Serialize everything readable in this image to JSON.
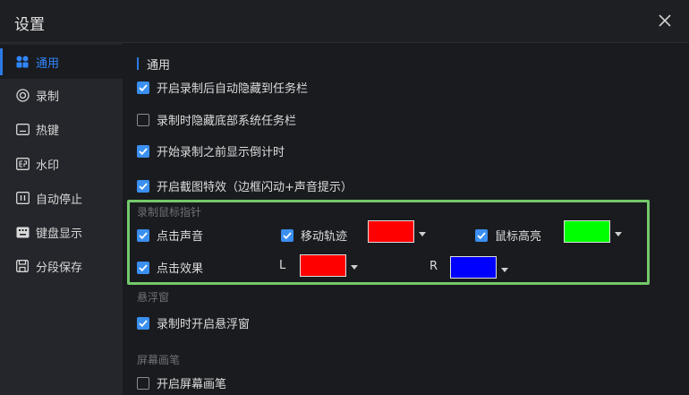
{
  "window": {
    "title": "设置"
  },
  "sidebar": {
    "items": [
      {
        "label": "通用",
        "icon": "grid-icon",
        "active": true
      },
      {
        "label": "录制",
        "icon": "record-icon"
      },
      {
        "label": "热键",
        "icon": "keyboard-icon"
      },
      {
        "label": "水印",
        "icon": "watermark-icon"
      },
      {
        "label": "自动停止",
        "icon": "stop-timer-icon"
      },
      {
        "label": "键盘显示",
        "icon": "keyboard-display-icon"
      },
      {
        "label": "分段保存",
        "icon": "save-icon"
      }
    ]
  },
  "general": {
    "title": "通用",
    "options": [
      {
        "label": "开启录制后自动隐藏到任务栏",
        "checked": true
      },
      {
        "label": "录制时隐藏底部系统任务栏",
        "checked": false
      },
      {
        "label": "开始录制之前显示倒计时",
        "checked": true
      },
      {
        "label": "开启截图特效（边框闪动+声音提示）",
        "checked": true
      }
    ]
  },
  "mouse": {
    "title": "录制鼠标指针",
    "click_sound": {
      "label": "点击声音",
      "checked": true
    },
    "move_track": {
      "label": "移动轨迹",
      "checked": true,
      "color": "#ff0000"
    },
    "highlight": {
      "label": "鼠标高亮",
      "checked": true,
      "color": "#00ff00"
    },
    "click_effect": {
      "label": "点击效果",
      "checked": true
    },
    "left": {
      "label": "L",
      "color": "#ff0000"
    },
    "right": {
      "label": "R",
      "color": "#0000ff"
    }
  },
  "floating": {
    "title": "悬浮窗",
    "option": {
      "label": "录制时开启悬浮窗",
      "checked": true
    }
  },
  "screen_pen": {
    "title": "屏幕画笔",
    "option": {
      "label": "开启屏幕画笔",
      "checked": false
    }
  },
  "colors": {
    "accent": "#2c7be5",
    "checkbox": "#3a8ff0",
    "highlight_border": "#73c96b"
  }
}
